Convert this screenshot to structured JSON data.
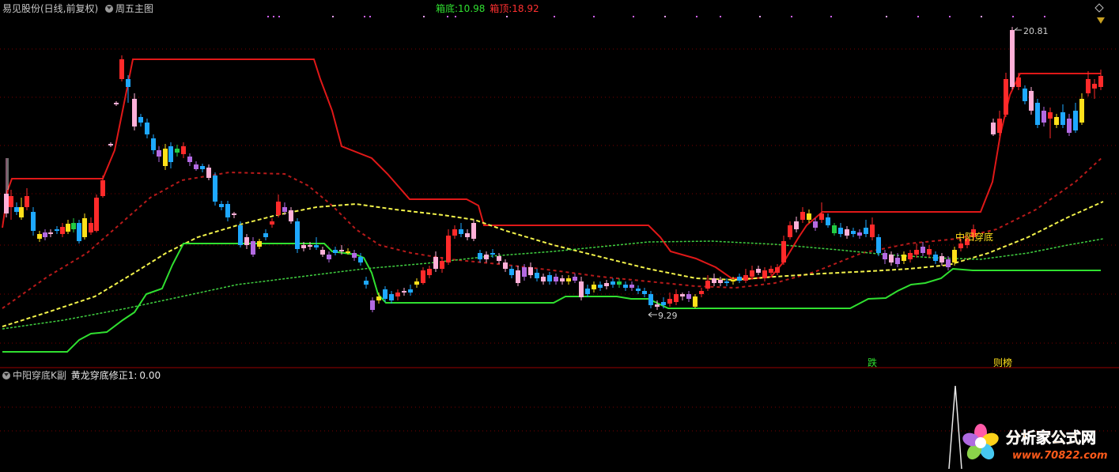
{
  "main_header": {
    "stock_title": "易见股份(日线,前复权)",
    "indicator_name": "周五主图",
    "box_bottom_label": "箱底:",
    "box_bottom_value": "10.98",
    "box_top_label": "箱顶:",
    "box_top_value": "18.92"
  },
  "sub_header": {
    "indicator_name": "中阳穿底K副",
    "formula_label": "黄龙穿底修正1:",
    "formula_value": "0.00"
  },
  "annotations": {
    "high_price": "20.81",
    "low_price": "9.29",
    "signal": "中阳穿底",
    "marker_fall": "跌",
    "marker_rank": "则榜"
  },
  "watermark": {
    "text": "分析家公式网",
    "url": "www.70822.com"
  },
  "colors": {
    "background": "#000000",
    "grid": "#7a0000",
    "box_line": "#e01818",
    "ma_yellow": "#f2f24a",
    "ma_red_dashed": "#b81a1a",
    "ma_green_dashed": "#40d040",
    "support_green": "#30e030",
    "candle_red": "#ff2a2a",
    "candle_cyan": "#1ea8ff",
    "candle_pink": "#ffb0d8",
    "candle_yellow": "#ffe01a",
    "candle_purple": "#b36ae2",
    "candle_green": "#22cc44"
  },
  "icons": [
    "dropdown-icon",
    "diamond-icon",
    "triangle-down-icon",
    "flower-logo-icon"
  ]
}
